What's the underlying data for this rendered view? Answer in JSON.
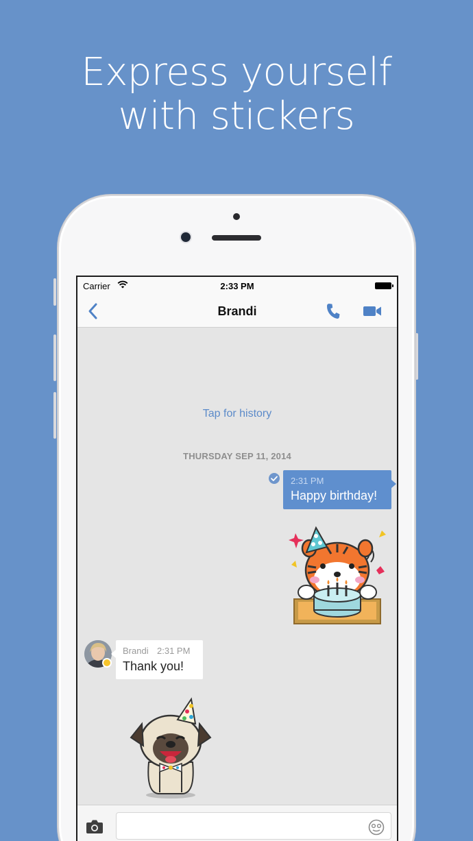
{
  "headline": {
    "line1": "Express yourself",
    "line2": "with stickers"
  },
  "status_bar": {
    "carrier": "Carrier",
    "time": "2:33 PM"
  },
  "nav": {
    "title": "Brandi",
    "icons": [
      "back-chevron-icon",
      "phone-icon",
      "video-camera-icon"
    ],
    "accent_color": "#4f82c6"
  },
  "chat": {
    "tap_history": "Tap for history",
    "date_separator": "THURSDAY SEP 11, 2014",
    "messages": [
      {
        "direction": "outgoing",
        "time": "2:31 PM",
        "text": "Happy birthday!",
        "status_icon": "read-check-icon"
      },
      {
        "direction": "outgoing",
        "sticker": "tiger-birthday-cake-sticker"
      },
      {
        "direction": "incoming",
        "sender": "Brandi",
        "time": "2:31 PM",
        "text": "Thank you!"
      },
      {
        "direction": "incoming",
        "sticker": "pug-party-hat-sticker"
      }
    ]
  },
  "input_bar": {
    "value": "",
    "placeholder": "",
    "icons": [
      "camera-icon",
      "sticker-face-icon"
    ]
  },
  "colors": {
    "background": "#6792c9",
    "outgoing_bubble": "#5f8fce",
    "incoming_bubble": "#ffffff",
    "chat_background": "#e5e5e5"
  }
}
